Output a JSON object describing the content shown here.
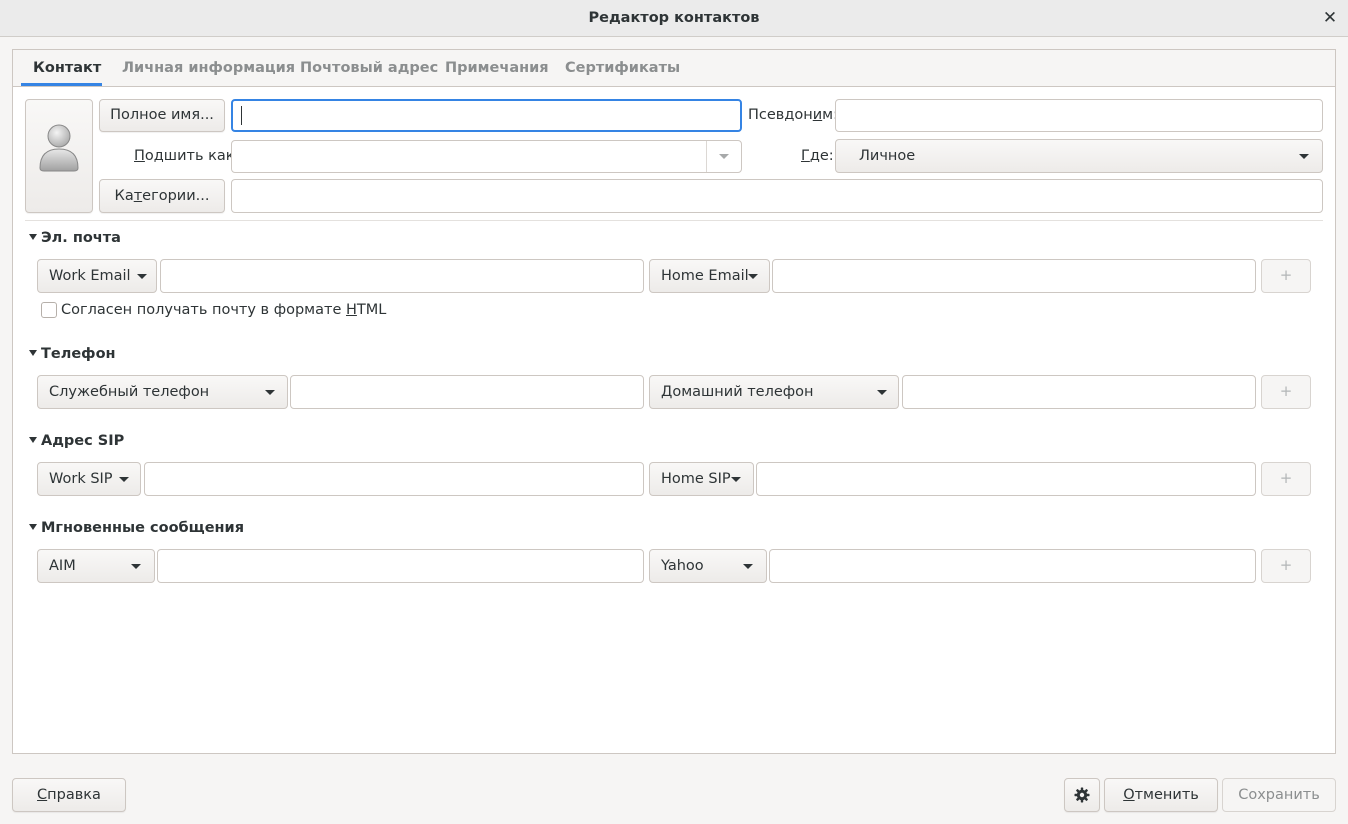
{
  "window": {
    "title": "Редактор контактов",
    "close_glyph": "✕"
  },
  "tabs": [
    {
      "label": "Контакт",
      "active": true
    },
    {
      "label": "Личная информация",
      "active": false
    },
    {
      "label": "Почтовый адрес",
      "active": false
    },
    {
      "label": "Примечания",
      "active": false
    },
    {
      "label": "Сертификаты",
      "active": false
    }
  ],
  "contact": {
    "avatar_icon": "user-avatar-icon",
    "fullname_button": "Полное имя...",
    "fullname_value": "",
    "nickname_label_pre": "Псевдон",
    "nickname_label_key": "и",
    "nickname_label_post": "м:",
    "nickname_value": "",
    "fileas_label_key": "П",
    "fileas_label_post": "одшить как:",
    "fileas_value": "",
    "where_label_key": "Г",
    "where_label_post": "де:",
    "where_value": "Личное",
    "categories_button_pre": "Ка",
    "categories_button_key": "т",
    "categories_button_post": "егории...",
    "categories_value": ""
  },
  "email": {
    "section_title": "Эл. почта",
    "type1": "Work Email",
    "value1": "",
    "type2": "Home Email",
    "value2": "",
    "add": "+",
    "html_checkbox_pre": "Согласен получать почту в формате ",
    "html_checkbox_key": "H",
    "html_checkbox_post": "TML",
    "html_checked": false
  },
  "phone": {
    "section_title": "Телефон",
    "type1": "Служебный телефон",
    "value1": "",
    "type2": "Домашний телефон",
    "value2": "",
    "add": "+"
  },
  "sip": {
    "section_title": "Адрес SIP",
    "type1": "Work SIP",
    "value1": "",
    "type2": "Home SIP",
    "value2": "",
    "add": "+"
  },
  "im": {
    "section_title": "Мгновенные сообщения",
    "type1": "AIM",
    "value1": "",
    "type2": "Yahoo",
    "value2": "",
    "add": "+"
  },
  "footer": {
    "help_key": "С",
    "help_post": "правка",
    "gear_icon": "gear-icon",
    "cancel_key": "О",
    "cancel_post": "тменить",
    "save": "Сохранить"
  },
  "colors": {
    "accent": "#3584e4",
    "window_bg": "#f6f5f4",
    "text": "#2e3436",
    "disabled": "#8b8e8f"
  }
}
